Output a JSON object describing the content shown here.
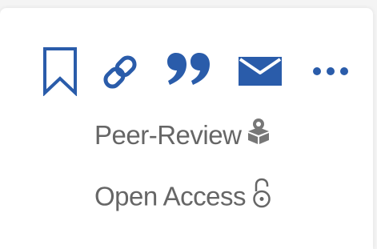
{
  "colors": {
    "primary": "#2a5caa",
    "text_muted": "#666666",
    "icon_muted": "#777777"
  },
  "toolbar": {
    "bookmark_icon": "bookmark-icon",
    "link_icon": "link-icon",
    "cite_icon": "quote-icon",
    "email_icon": "envelope-icon",
    "more_icon": "more-horizontal-icon"
  },
  "badges": {
    "peer_review_label": "Peer-Review",
    "peer_review_icon": "peer-review-icon",
    "open_access_label": "Open Access",
    "open_access_icon": "unlocked-padlock-icon"
  }
}
